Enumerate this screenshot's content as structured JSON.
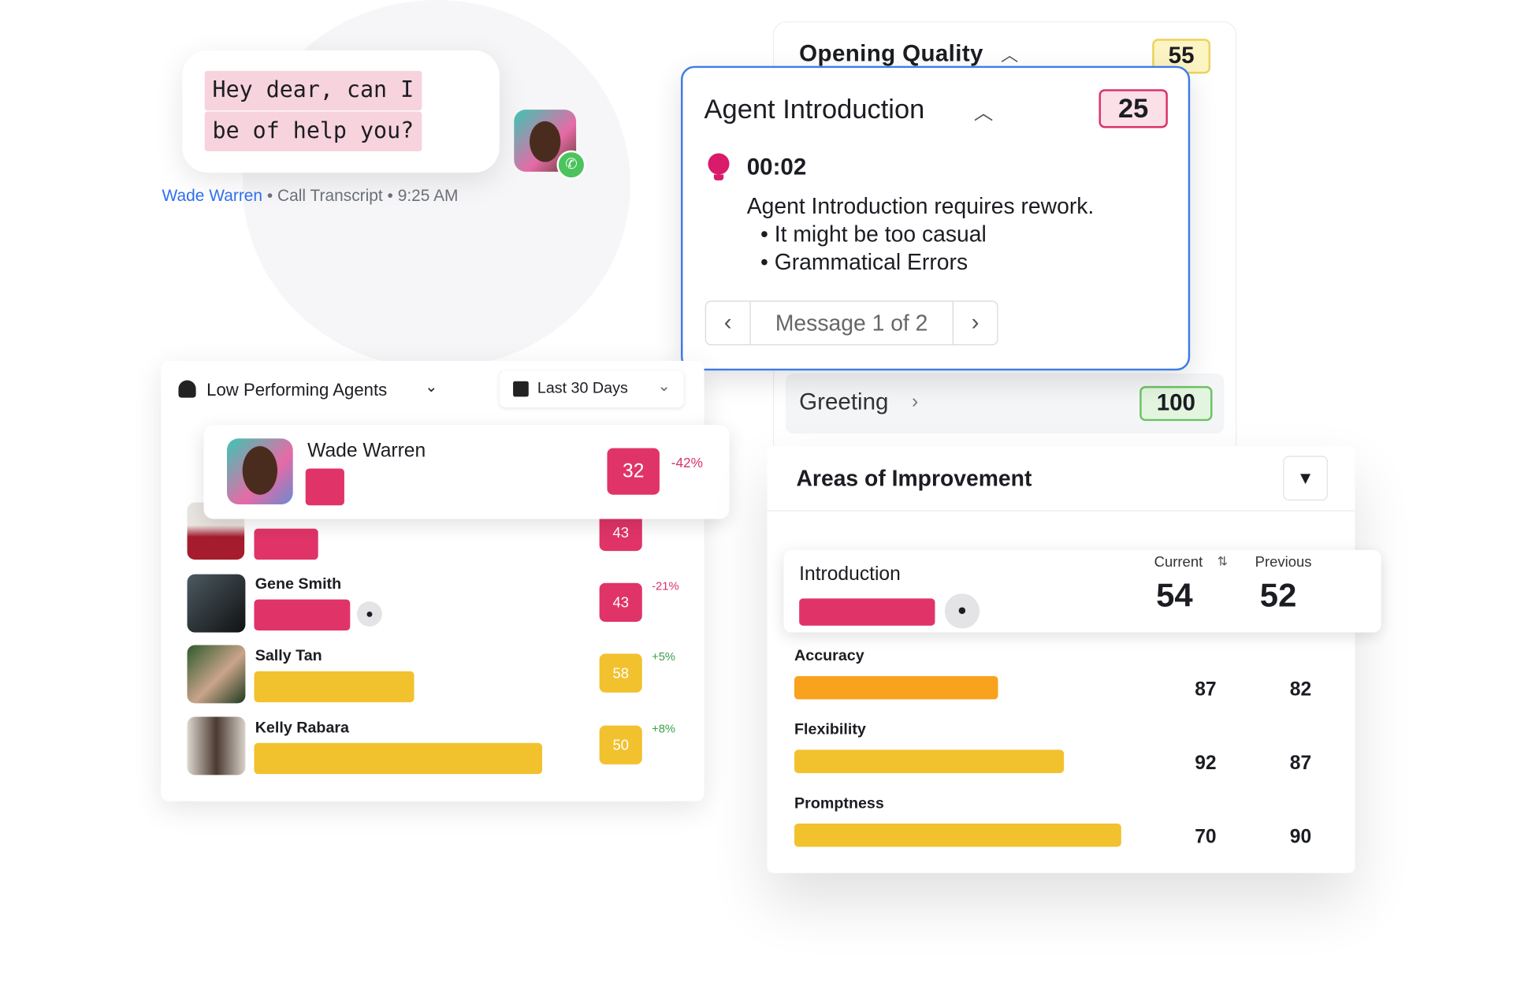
{
  "chat": {
    "message_line1": "Hey dear, can I",
    "message_line2": "be of help you?",
    "agent": "Wade Warren",
    "meta": "• Call Transcript • 9:25 AM"
  },
  "opening_quality": {
    "title": "Opening Quality",
    "score": "55"
  },
  "agent_intro": {
    "title": "Agent Introduction",
    "score": "25",
    "timestamp": "00:02",
    "feedback": "Agent Introduction requires rework.",
    "bullets": [
      "It might be too casual",
      "Grammatical Errors"
    ],
    "pager": "Message 1 of 2"
  },
  "greeting": {
    "title": "Greeting",
    "score": "100"
  },
  "agents_panel": {
    "title": "Low Performing Agents",
    "date_range": "Last 30 Days",
    "agents": [
      {
        "name": "Wade Warren",
        "score": "32",
        "change": "-42%",
        "bar_pct": 12
      },
      {
        "name": "",
        "score": "43",
        "change": "",
        "bar_pct": 20
      },
      {
        "name": "Gene Smith",
        "score": "43",
        "change": "-21%",
        "bar_pct": 30
      },
      {
        "name": "Sally Tan",
        "score": "58",
        "change": "+5%",
        "bar_pct": 50
      },
      {
        "name": "Kelly Rabara",
        "score": "50",
        "change": "+8%",
        "bar_pct": 90
      }
    ]
  },
  "areas": {
    "title": "Areas of Improvement",
    "current_label": "Current",
    "previous_label": "Previous",
    "items": [
      {
        "name": "Introduction",
        "current": "54",
        "previous": "52"
      },
      {
        "name": "Accuracy",
        "current": "87",
        "previous": "82"
      },
      {
        "name": "Flexibility",
        "current": "92",
        "previous": "87"
      },
      {
        "name": "Promptness",
        "current": "70",
        "previous": "90"
      }
    ]
  },
  "colors": {
    "pink": "#e03468",
    "orange": "#f8a21e",
    "yellow": "#f2c12e",
    "blue": "#2f6fed",
    "green": "#3aa14a"
  }
}
